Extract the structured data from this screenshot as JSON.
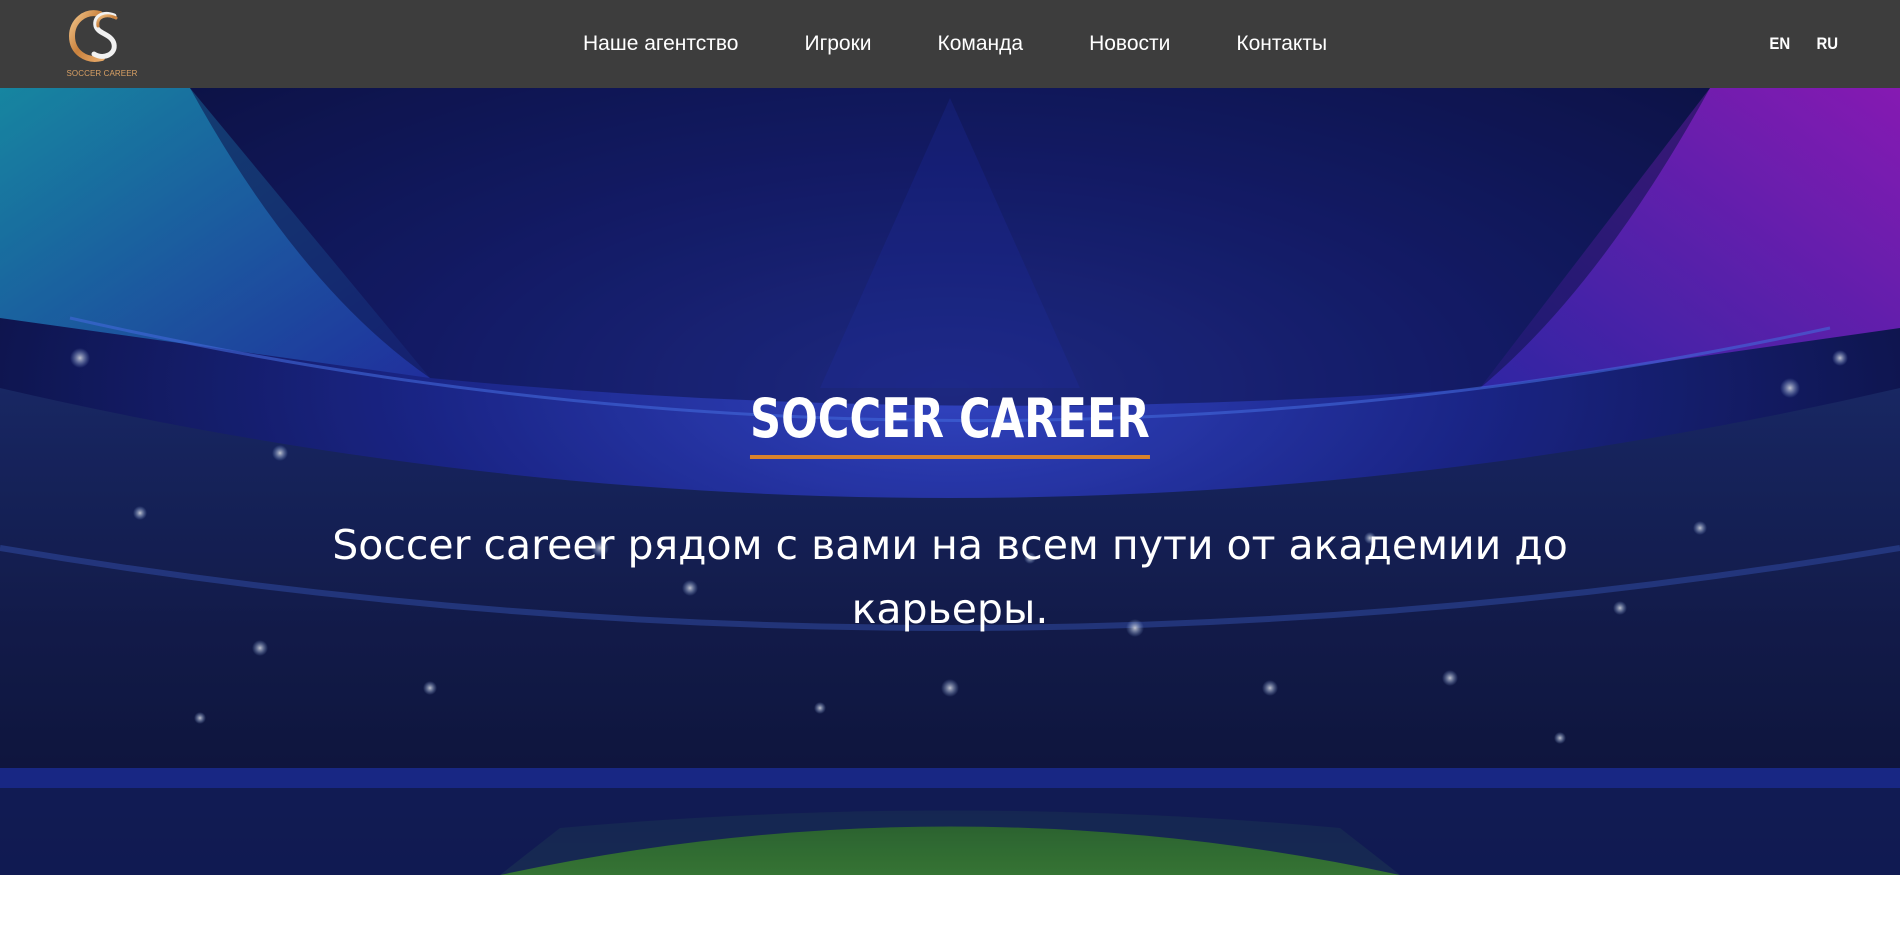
{
  "brand": {
    "logo_text": "SOCCER CAREER",
    "accent_color": "#d9822b"
  },
  "nav": {
    "items": [
      {
        "label": "Наше агентство"
      },
      {
        "label": "Игроки"
      },
      {
        "label": "Команда"
      },
      {
        "label": "Новости"
      },
      {
        "label": "Контакты"
      }
    ]
  },
  "languages": [
    "EN",
    "RU"
  ],
  "hero": {
    "title": "SOCCER CAREER",
    "subtitle": "Soccer career рядом с вами на всем пути от академии до карьеры.",
    "background": "stadium-night-image"
  },
  "colors": {
    "navbar_bg": "#3d3d3d",
    "hero_dark": "#0d1240",
    "hero_blue": "#2a3ad0",
    "hero_cyan": "#1aa0c4",
    "hero_magenta": "#9a20d8",
    "pitch_green": "#2f7a2a"
  }
}
